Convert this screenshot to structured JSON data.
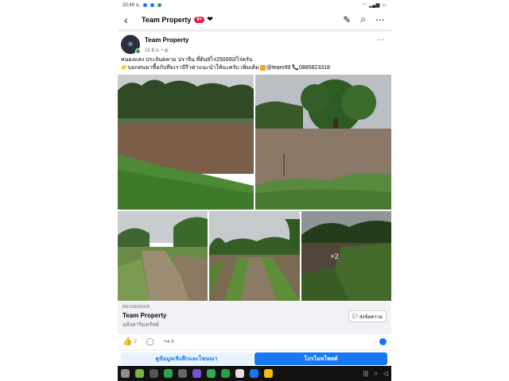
{
  "status": {
    "time": "20:49 น.",
    "battery": ""
  },
  "header": {
    "title": "Team Property",
    "badge": "9+"
  },
  "post": {
    "author": "Team Property",
    "meta": "15 มิ.ย. • ",
    "line1": "หนองแสง ประจันตคาม ปราจีน ที่ดิน9ไร่250000/ไร่ครับ",
    "line2": "👉บอกคนมาซื้อกับทีมเรามีรีวค่าแนะนำให้นะครับ เพิ่มเติม",
    "line2_tail": "@team99 📞0885823318",
    "more_photos": "+2"
  },
  "messenger": {
    "label": "MESSENGER",
    "name": "Team Property",
    "sub": "อสังหาริมทรัพย์",
    "button": "ส่งข้อความ"
  },
  "reactions": {
    "likes": "2",
    "shares": "6"
  },
  "buttons": {
    "insights": "ดูข้อมูลเชิงลึกและโฆษณา",
    "promote": "โปรโมทโพสต์"
  },
  "colors": {
    "accent": "#1877f2",
    "badge": "#e41e3f",
    "online": "#31a24c"
  }
}
